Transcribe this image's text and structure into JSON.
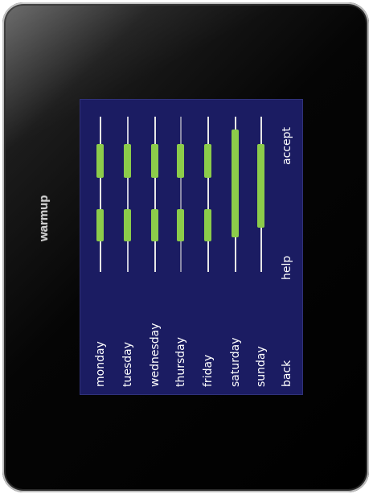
{
  "brand": "warmup",
  "days": [
    {
      "label": "monday"
    },
    {
      "label": "tuesday"
    },
    {
      "label": "wednesday"
    },
    {
      "label": "thursday"
    },
    {
      "label": "friday"
    },
    {
      "label": "saturday"
    },
    {
      "label": "sunday"
    }
  ],
  "buttons": {
    "back": "back",
    "help": "help",
    "accept": "accept"
  },
  "colors": {
    "screen_bg": "#1b1c62",
    "schedule_bar": "#8ccc4a",
    "timeline": "#e6e6e6",
    "bezel": "#000000"
  }
}
